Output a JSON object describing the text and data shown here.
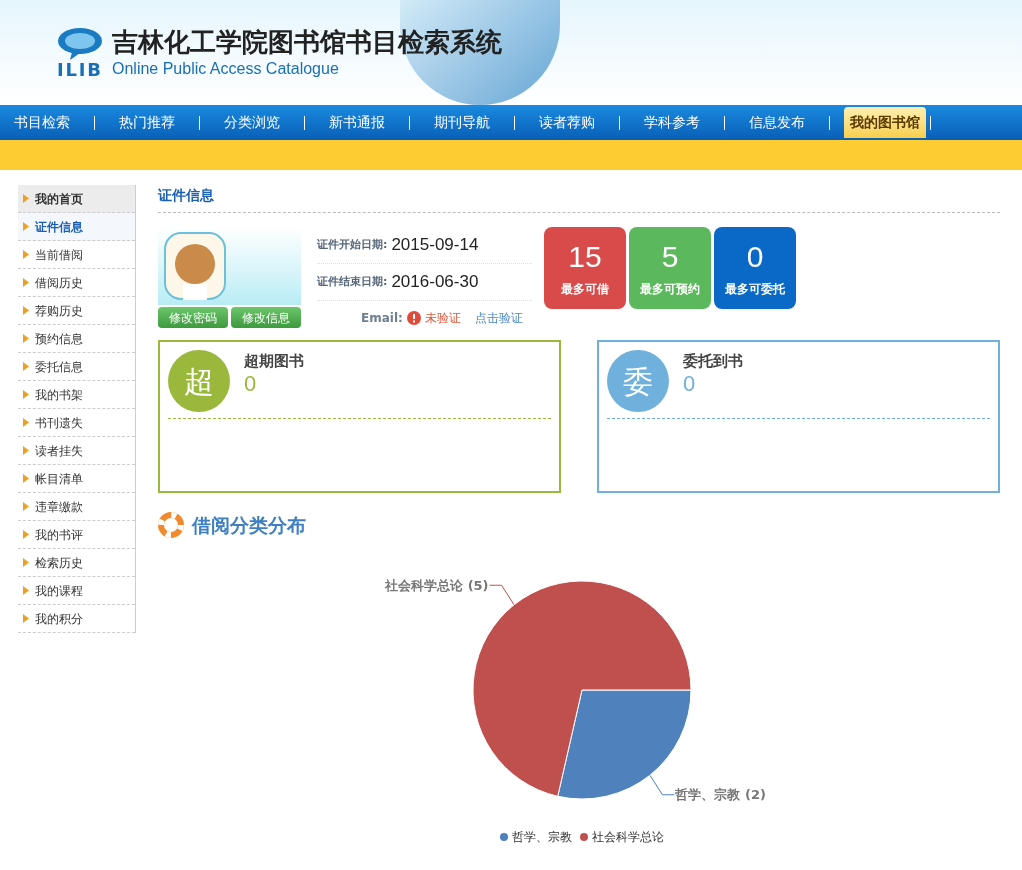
{
  "header": {
    "logo_text": "ILIB",
    "title": "吉林化工学院图书馆书目检索系统",
    "subtitle": "Online Public Access Catalogue"
  },
  "nav": [
    {
      "label": "书目检索",
      "selected": false
    },
    {
      "label": "热门推荐",
      "selected": false
    },
    {
      "label": "分类浏览",
      "selected": false
    },
    {
      "label": "新书通报",
      "selected": false
    },
    {
      "label": "期刊导航",
      "selected": false
    },
    {
      "label": "读者荐购",
      "selected": false
    },
    {
      "label": "学科参考",
      "selected": false
    },
    {
      "label": "信息发布",
      "selected": false
    },
    {
      "label": "我的图书馆",
      "selected": true
    }
  ],
  "sidebar": {
    "items": [
      {
        "label": "我的首页",
        "kind": "home",
        "selected": false
      },
      {
        "label": "证件信息",
        "kind": "link",
        "selected": true
      },
      {
        "label": "当前借阅",
        "kind": "link",
        "selected": false
      },
      {
        "label": "借阅历史",
        "kind": "link",
        "selected": false
      },
      {
        "label": "荐购历史",
        "kind": "link",
        "selected": false
      },
      {
        "label": "预约信息",
        "kind": "link",
        "selected": false
      },
      {
        "label": "委托信息",
        "kind": "link",
        "selected": false
      },
      {
        "label": "我的书架",
        "kind": "link",
        "selected": false
      },
      {
        "label": "书刊遗失",
        "kind": "link",
        "selected": false
      },
      {
        "label": "读者挂失",
        "kind": "link",
        "selected": false
      },
      {
        "label": "帐目清单",
        "kind": "link",
        "selected": false
      },
      {
        "label": "违章缴款",
        "kind": "link",
        "selected": false
      },
      {
        "label": "我的书评",
        "kind": "link",
        "selected": false
      },
      {
        "label": "检索历史",
        "kind": "link",
        "selected": false
      },
      {
        "label": "我的课程",
        "kind": "link",
        "selected": false
      },
      {
        "label": "我的积分",
        "kind": "link",
        "selected": false
      }
    ]
  },
  "card_info": {
    "title": "证件信息",
    "buttons": [
      "修改密码",
      "修改信息"
    ],
    "fields": [
      {
        "label": "证件开始日期:",
        "value": "2015-09-14"
      },
      {
        "label": "证件结束日期:",
        "value": "2016-06-30"
      }
    ],
    "email": {
      "label": "Email:",
      "status": "未验证",
      "verified": false,
      "action": "点击验证"
    },
    "stats": [
      {
        "value": "15",
        "label": "最多可借",
        "color": "#d94a4a"
      },
      {
        "value": "5",
        "label": "最多可预约",
        "color": "#5cb85c"
      },
      {
        "value": "0",
        "label": "最多可委托",
        "color": "#0a68c6"
      }
    ]
  },
  "panels": [
    {
      "badge": "超",
      "title": "超期图书",
      "count": "0",
      "color": "#9ab83c"
    },
    {
      "badge": "委",
      "title": "委托到书",
      "count": "0",
      "color": "#6fb0dc"
    }
  ],
  "chart_section": {
    "title": "借阅分类分布",
    "chart_data": {
      "type": "pie",
      "categories": [
        "哲学、宗教",
        "社会科学总论"
      ],
      "values": [
        2,
        5
      ],
      "colors": [
        "#4f81bd",
        "#c0504d"
      ],
      "data_labels": true,
      "legend": "bottom",
      "value_labels": [
        "(2)",
        "(5)"
      ]
    }
  }
}
